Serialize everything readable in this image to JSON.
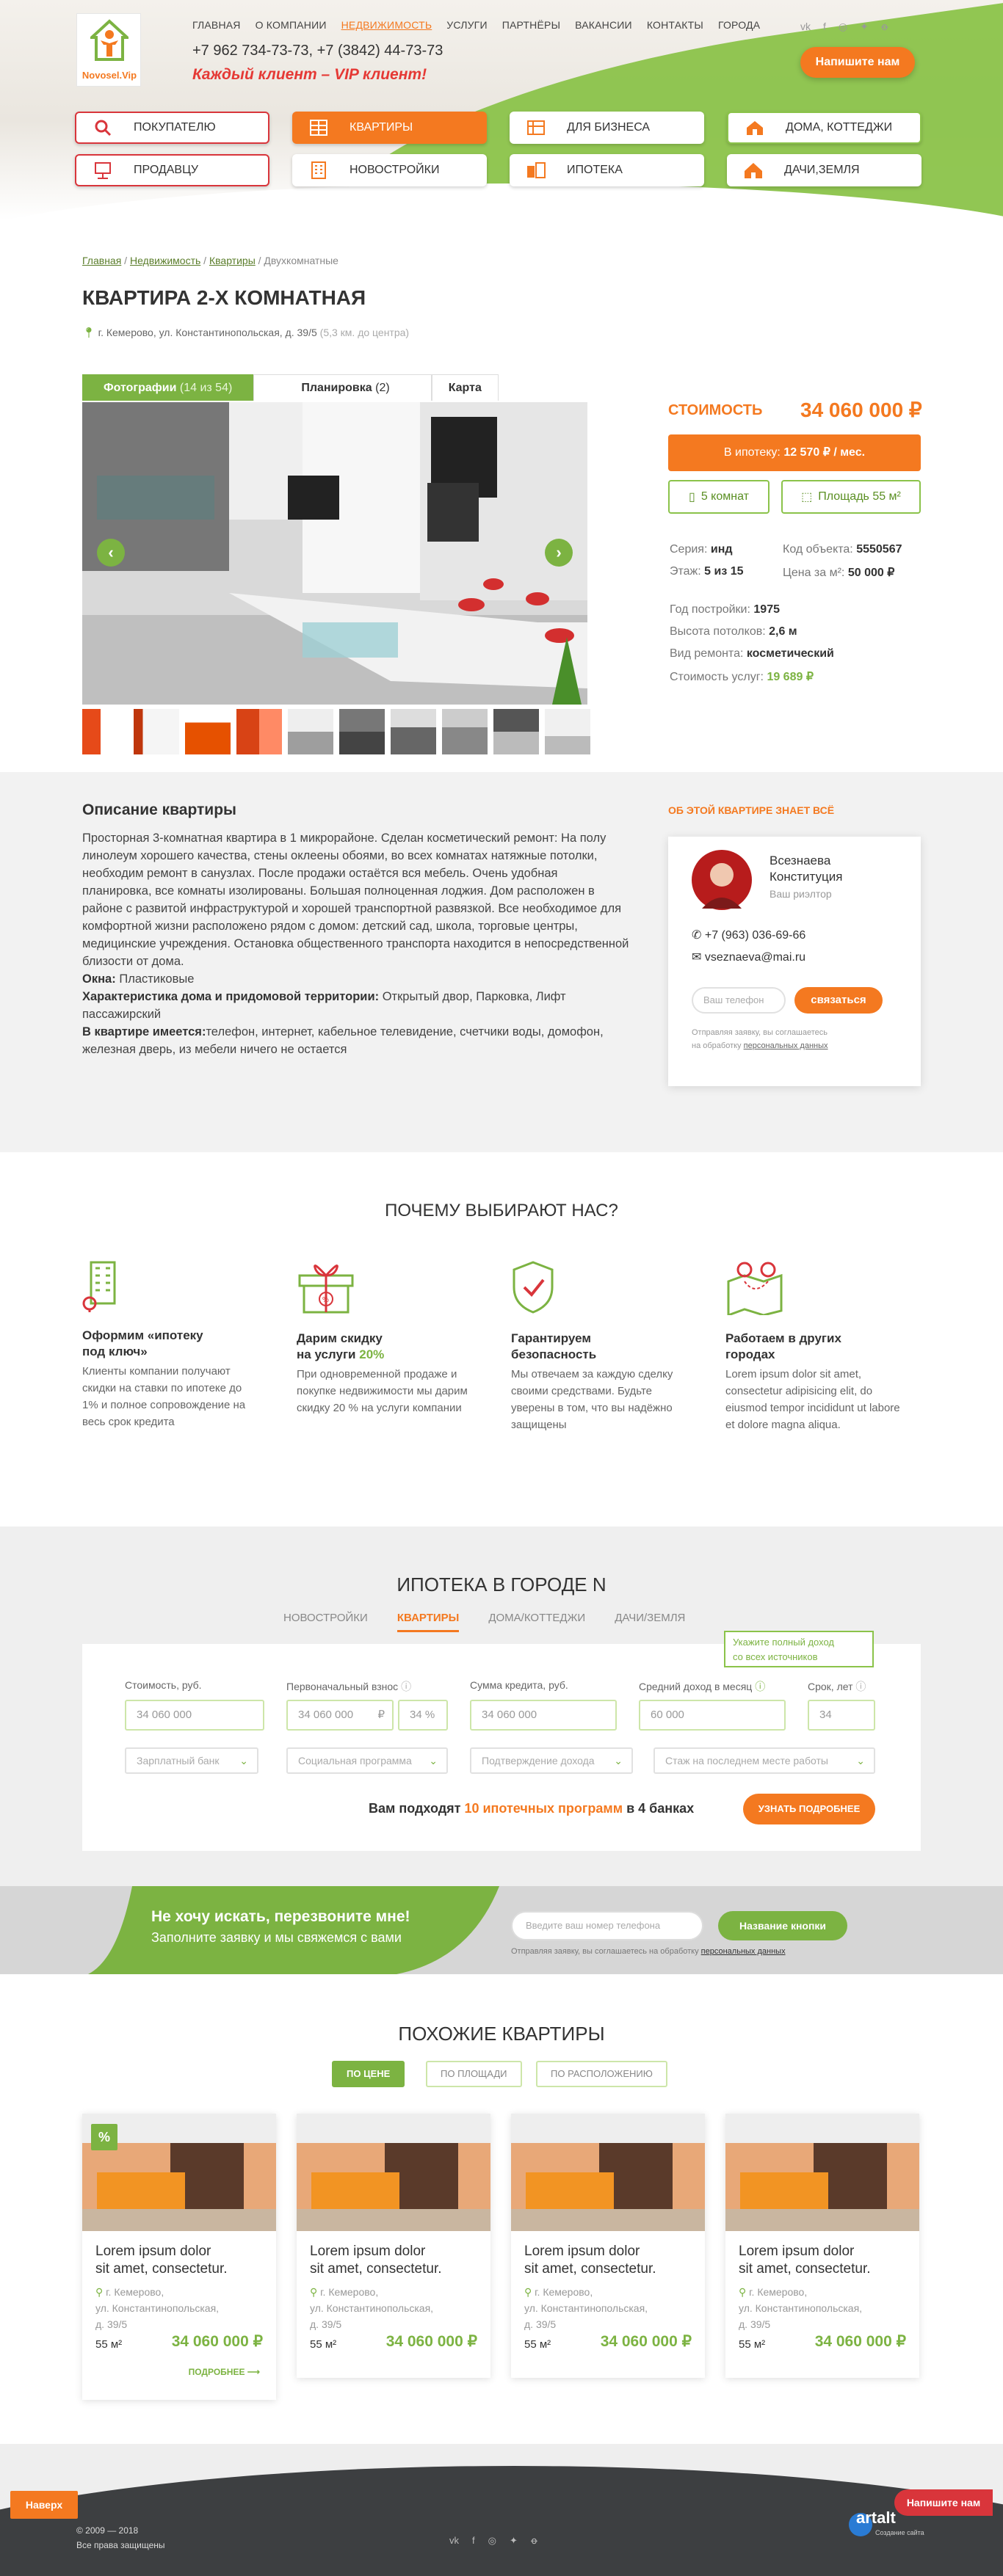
{
  "header": {
    "logo_text": "Novosel.Vip",
    "nav": [
      "ГЛАВНАЯ",
      "О КОМПАНИИ",
      "НЕДВИЖИМОСТЬ",
      "УСЛУГИ",
      "ПАРТНЁРЫ",
      "ВАКАНСИИ",
      "КОНТАКТЫ",
      "ГОРОДА"
    ],
    "phones": "+7 962 734-73-73, +7 (3842) 44-73-73",
    "slogan": "Каждый клиент – VIP клиент!",
    "social": [
      "vk",
      "f",
      "ig",
      "tw",
      "ok"
    ],
    "write_btn": "Напишите нам",
    "categories": [
      {
        "label": "ПОКУПАТЕЛЮ",
        "icon": "search-icon"
      },
      {
        "label": "КВАРТИРЫ",
        "icon": "apartment-icon"
      },
      {
        "label": "ДЛЯ БИЗНЕСА",
        "icon": "business-icon"
      },
      {
        "label": "ДОМА, КОТТЕДЖИ",
        "icon": "house-icon"
      },
      {
        "label": "ПРОДАВЦУ",
        "icon": "seller-icon"
      },
      {
        "label": "НОВОСТРОЙКИ",
        "icon": "building-icon"
      },
      {
        "label": "ИПОТЕКА",
        "icon": "mortgage-icon"
      },
      {
        "label": "ДАЧИ,ЗЕМЛЯ",
        "icon": "cottage-icon"
      }
    ]
  },
  "breadcrumbs": [
    "Главная",
    "Недвижимость",
    "Квартиры",
    "Двухкомнатные"
  ],
  "title": "КВАРТИРА 2-Х КОМНАТНАЯ",
  "address": "г. Кемерово, ул. Константинопольская, д. 39/5",
  "address_dist": "(5,3 км. до центра)",
  "tabs": {
    "photos": "Фотографии",
    "photos_count": "(14 из 54)",
    "layout": "Планировка",
    "layout_count": "(2)",
    "map": "Карта"
  },
  "price": {
    "label": "СТОИМОСТЬ",
    "value": "34 060 000 ₽",
    "mortgage_prefix": "В ипотеку:",
    "mortgage_value": "12 570 ₽ / мес."
  },
  "chips": {
    "rooms": "5 комнат",
    "area": "Площадь 55 м²"
  },
  "specs": {
    "series_l": "Серия:",
    "series_v": "инд",
    "code_l": "Код объекта:",
    "code_v": "5550567",
    "floor_l": "Этаж:",
    "floor_v": "5 из 15",
    "ppm_l": "Цена за м²:",
    "ppm_v": "50 000 ₽",
    "year_l": "Год постройки:",
    "year_v": "1975",
    "ceil_l": "Высота потолков:",
    "ceil_v": "2,6 м",
    "repair_l": "Вид ремонта:",
    "repair_v": "косметический",
    "serv_l": "Стоимость услуг:",
    "serv_v": "19 689 ₽"
  },
  "description": {
    "title": "Описание квартиры",
    "text": "Просторная 3-комнатная квартира в 1 микрорайоне. Сделан косметический ремонт: На полу линолеум хорошего качества, стены оклеены обоями, во всех комнатах натяжные потолки, необходим ремонт в санузлах. После продажи остаётся вся мебель. Очень удобная планировка, все комнаты изолированы. Большая полноценная лоджия. Дом расположен в районе с развитой инфраструктурой и хорошей транспортной развязкой. Все необходимое для комфортной жизни расположено рядом с домом: детский сад, школа, торговые центры, медицинские учреждения. Остановка общественного транспорта находится в непосредственной близости от дома.",
    "windows_l": "Окна:",
    "windows_v": "Пластиковые",
    "terr_l": "Характеристика дома и придомовой территории:",
    "terr_v": "Открытый двор, Парковка, Лифт пассажирский",
    "has_l": "В квартире имеется:",
    "has_v": "телефон, интернет, кабельное телевидение, счетчики воды, домофон, железная дверь, из мебели ничего не остается"
  },
  "agent": {
    "header": "ОБ ЭТОЙ КВАРТИРЕ ЗНАЕТ ВСЁ",
    "name1": "Всезнаева",
    "name2": "Конституция",
    "role": "Ваш риэлтор",
    "phone": "+7 (963) 036-69-66",
    "email": "vseznaeva@mai.ru",
    "input_ph": "Ваш телефон",
    "btn": "связаться",
    "consent1": "Отправляя заявку, вы соглашаетесь",
    "consent2": "на обработку",
    "consent_link": "персональных данных"
  },
  "why": {
    "title": "ПОЧЕМУ ВЫБИРАЮТ НАС?",
    "items": [
      {
        "t1": "Оформим «ипотеку",
        "t2": "под ключ»",
        "d": "Клиенты компании получают скидки на ставки по ипотеке до 1% и полное сопровождение на весь срок кредита"
      },
      {
        "t1": "Дарим скидку",
        "t2": "на услуги",
        "pct": "20%",
        "d": "При одновременной продаже и покупке недвижимости мы дарим скидку 20 % на услуги компании"
      },
      {
        "t1": "Гарантируем",
        "t2": "безопасность",
        "d": "Мы отвечаем за каждую сделку своими средствами. Будьте уверены в том, что вы надёжно защищены"
      },
      {
        "t1": "Работаем в других",
        "t2": "городах",
        "d": "Lorem ipsum dolor sit amet, consectetur adipisicing elit, do eiusmod tempor incididunt ut labore et dolore magna aliqua."
      }
    ]
  },
  "mortgage": {
    "title": "ИПОТЕКА В ГОРОДЕ N",
    "tabs": [
      "НОВОСТРОЙКИ",
      "КВАРТИРЫ",
      "ДОМА/КОТТЕДЖИ",
      "ДАЧИ/ЗЕМЛЯ"
    ],
    "tooltip1": "Укажите полный доход",
    "tooltip2": "со всех источников",
    "l_cost": "Стоимость, руб.",
    "v_cost": "34 060 000",
    "l_first": "Первоначальный взнос",
    "v_first": "34 060 000",
    "v_first_cur": "₽",
    "v_first_pct": "34",
    "v_pct_sign": "%",
    "l_sum": "Сумма кредита, руб.",
    "v_sum": "34 060 000",
    "l_income": "Средний доход в месяц",
    "v_income": "60 000",
    "l_term": "Срок, лет",
    "v_term": "34",
    "sel": [
      "Зарплатный банк",
      "Социальная программа",
      "Подтверждение дохода",
      "Стаж на последнем месте работы"
    ],
    "result_pre": "Вам подходят",
    "result_link": "10 ипотечных программ",
    "result_post": "в 4 банках",
    "btn": "УЗНАТЬ ПОДРОБНЕЕ"
  },
  "callback": {
    "t1": "Не хочу искать, перезвоните мне!",
    "t2": "Заполните заявку и мы свяжемся с вами",
    "ph": "Введите ваш номер телефона",
    "btn": "Название кнопки",
    "consent": "Отправляя заявку, вы соглашаетесь на обработку",
    "consent_link": "персональных данных"
  },
  "similar": {
    "title": "ПОХОЖИЕ КВАРТИРЫ",
    "filters": [
      "ПО ЦЕНЕ",
      "ПО ПЛОЩАДИ",
      "ПО РАСПОЛОЖЕНИЮ"
    ],
    "cards": [
      {
        "t1": "Lorem ipsum dolor",
        "t2": "sit amet, consectetur.",
        "a1": "г. Кемерово,",
        "a2": "ул. Константинопольская,",
        "a3": "д. 39/5",
        "size": "55 м²",
        "price": "34 060 000 ₽",
        "more": "ПОДРОБНЕЕ",
        "badge": "%"
      },
      {
        "t1": "Lorem ipsum dolor",
        "t2": "sit amet, consectetur.",
        "a1": "г. Кемерово,",
        "a2": "ул. Константинопольская,",
        "a3": "д. 39/5",
        "size": "55 м²",
        "price": "34 060 000 ₽"
      },
      {
        "t1": "Lorem ipsum dolor",
        "t2": "sit amet, consectetur.",
        "a1": "г. Кемерово,",
        "a2": "ул. Константинопольская,",
        "a3": "д. 39/5",
        "size": "55 м²",
        "price": "34 060 000 ₽"
      },
      {
        "t1": "Lorem ipsum dolor",
        "t2": "sit amet, consectetur.",
        "a1": "г. Кемерово,",
        "a2": "ул. Константинопольская,",
        "a3": "д. 39/5",
        "size": "55 м²",
        "price": "34 060 000 ₽"
      }
    ]
  },
  "footer": {
    "up": "Наверх",
    "copy": "© 2009 — 2018",
    "rights": "Все права защищены",
    "write": "Напишите нам",
    "dev": "artalt",
    "dev_sub": "Создание сайта"
  }
}
